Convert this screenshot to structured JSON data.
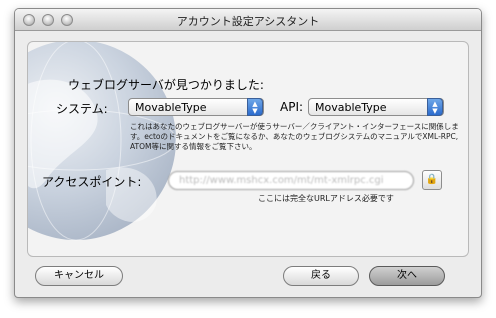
{
  "window": {
    "title": "アカウント設定アシスタント"
  },
  "main": {
    "heading": "ウェブログサーバが見つかりました:",
    "system_label": "システム:",
    "system_value": "MovableType",
    "api_label": "API:",
    "api_value": "MovableType",
    "description": "これはあなたのウェブログサーバーが使うサーバー／クライアント・インターフェースに関係します。ectoのドキュメントをご覧になるか、あなたのウェブログシステムのマニュアルでXML-RPC, ATOM等に関する情報をご覧下さい。",
    "access_label": "アクセスポイント:",
    "access_value": "http://www.mshcx.com/mt/mt-xmlrpc.cgi",
    "hint": "ここには完全なURLアドレス必要です"
  },
  "footer": {
    "cancel_label": "キャンセル",
    "back_label": "戻る",
    "next_label": "次へ"
  },
  "icons": {
    "lock": "lock-icon",
    "globe": "globe-icon",
    "select_arrows": "updown-arrows-icon"
  },
  "colors": {
    "accent": "#2b6bcd",
    "window_bg": "#ececec"
  }
}
